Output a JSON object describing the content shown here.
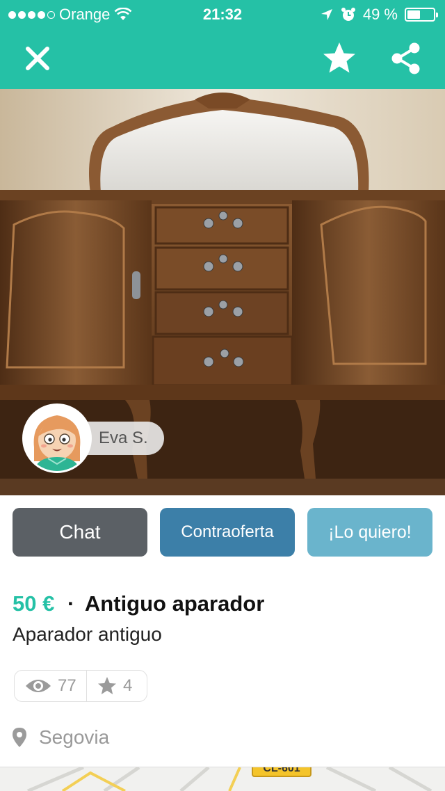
{
  "status_bar": {
    "carrier": "Orange",
    "time": "21:32",
    "battery": "49 %",
    "battery_level": 0.49,
    "signal_dots_filled": 4,
    "signal_dots_total": 5
  },
  "nav": {
    "icons": [
      "close-icon",
      "star-icon",
      "share-icon"
    ]
  },
  "seller": {
    "name": "Eva S."
  },
  "actions": {
    "chat": "Chat",
    "offer": "Contraoferta",
    "want": "¡Lo quiero!"
  },
  "item": {
    "price": "50 €",
    "separator": "·",
    "title": "Antiguo aparador",
    "description": "Aparador antiguo"
  },
  "stats": {
    "views": "77",
    "favorites": "4"
  },
  "location": {
    "city": "Segovia"
  },
  "map": {
    "road_label": "CL-601"
  },
  "colors": {
    "brand": "#25c1a6",
    "chat_button": "#5b6065",
    "offer_button": "#3c7fa8",
    "want_button": "#6ab4cc"
  }
}
